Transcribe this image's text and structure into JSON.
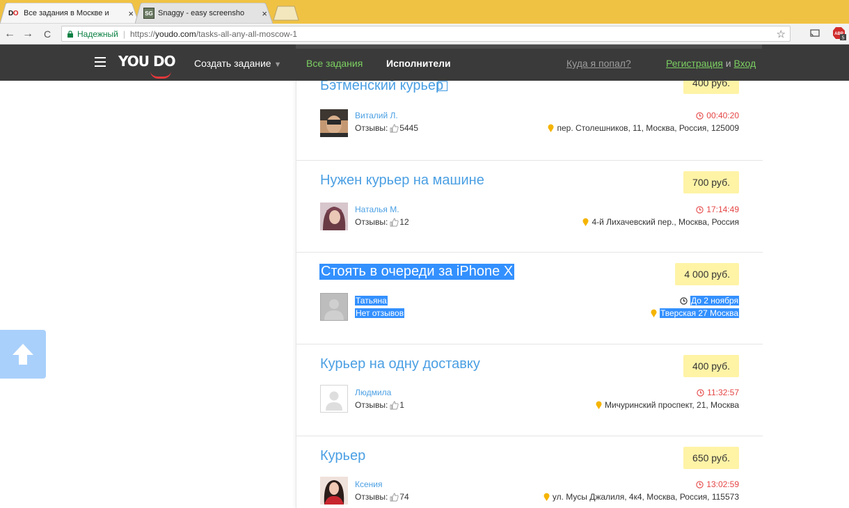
{
  "browser": {
    "tabs": [
      {
        "title": "Все задания в Москве и",
        "favicon": "youdo-favicon",
        "close": "×",
        "active": true
      },
      {
        "title": "Snaggy - easy screensho",
        "favicon": "snaggy-favicon",
        "close": "×",
        "active": false
      }
    ],
    "nav": {
      "back": "←",
      "forward": "→",
      "reload": "C"
    },
    "address": {
      "secure_label": "Надежный",
      "url_scheme": "https://",
      "url_host": "youdo.com",
      "url_path": "/tasks-all-any-all-moscow-1"
    },
    "extensions": {
      "bookmark_star": "☆",
      "abp_badge": "5"
    }
  },
  "site_header": {
    "logo": "YOU DO",
    "create_task": "Создать задание",
    "all_tasks": "Все задания",
    "performers": "Исполнители",
    "where_am_i": "Куда я попал?",
    "register": "Регистрация",
    "and": "и",
    "login": "Вход"
  },
  "cards": [
    {
      "title": "Бэтменский курьер",
      "price": "400 руб.",
      "user": "Виталий Л.",
      "reviews_label": "Отзывы:",
      "reviews_count": "5445",
      "time": "00:40:20",
      "address": "пер. Столешников, 11, Москва, Россия, 125009"
    },
    {
      "title": "Нужен курьер на машине",
      "price": "700 руб.",
      "user": "Наталья М.",
      "reviews_label": "Отзывы:",
      "reviews_count": "12",
      "time": "17:14:49",
      "address": "4-й Лихачевский пер., Москва, Россия"
    },
    {
      "title": "Стоять в очереди за iPhone X",
      "price": "4 000 руб.",
      "user": "Татьяна",
      "reviews_label": "Нет отзывов",
      "reviews_count": "",
      "time": "До 2 ноября",
      "address": "Тверская 27 Москва"
    },
    {
      "title": "Курьер на одну доставку",
      "price": "400 руб.",
      "user": "Людмила",
      "reviews_label": "Отзывы:",
      "reviews_count": "1",
      "time": "11:32:57",
      "address": "Мичуринский проспект, 21, Москва"
    },
    {
      "title": "Курьер",
      "price": "650 руб.",
      "user": "Ксения",
      "reviews_label": "Отзывы:",
      "reviews_count": "74",
      "time": "13:02:59",
      "address": "ул. Мусы Джалиля, 4к4, Москва, Россия, 115573"
    }
  ],
  "colors": {
    "link_blue": "#4a9fe3",
    "price_bg": "#fff3a6",
    "timer_red": "#e54444",
    "header_bg": "#3a3a3a",
    "nav_green": "#7cd062",
    "selection": "#3390ff",
    "pin_yellow": "#f5b400"
  }
}
